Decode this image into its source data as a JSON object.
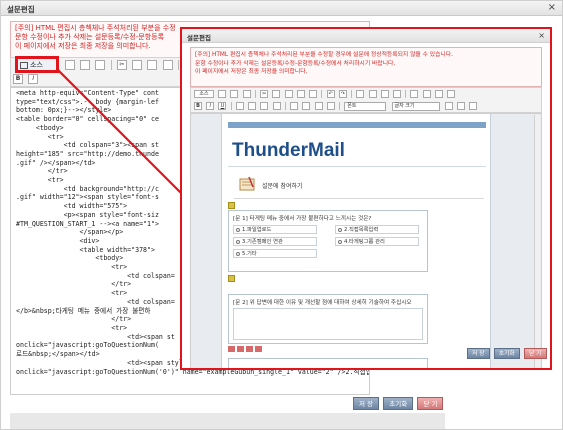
{
  "outer": {
    "title": "설문편집",
    "close_icon": "×",
    "notice_lines": [
      "[주의] HTML 편집시 층첵체나 주석처리된 부분을 수정",
      "문항 수정이나 추가 삭제는 설문등록/수정-문항등록",
      "이 페이지에서 저장은 최종 저장을 의미합니다."
    ],
    "source_button_label": "소스",
    "code_lines": [
      "<meta http-equiv=\"Content-Type\" cont",
      "type=\"text/css\">.-- body {margin-lef",
      "bottom: 0px;}--></style>",
      "<table border=\"0\" cellspacing=\"0\" ce",
      "     <tbody>",
      "        <tr>",
      "            <td colspan=\"3\"><span st",
      "height=\"185\" src=\"http://demo.thunde",
      ".gif\" /></span></td>",
      "        </tr>",
      "        <tr>",
      "            <td background=\"http://c",
      ".gif\" width=\"12\"><span style=\"font-s",
      "            <td width=\"575\">",
      "            <p><span style=\"font-siz",
      "#TM_QUESTION_START_1 --><a name=\"1\">",
      "                </span></p>",
      "                <div>",
      "                <table width=\"378\">",
      "                    <tbody>",
      "                        <tr>",
      "                            <td colspan=",
      "                        </tr>",
      "                        <tr>",
      "                            <td colspan=",
      "</b>&nbsp;타게팅 메뉴 중에서 가장 불편하",
      "                        </tr>",
      "                        <tr>",
      "                            <td><span st",
      "onclick=\"javascript:goToQuestionNum(",
      "로드&nbsp;</span></td>",
      "                            <td><span style=\"font-size: smaller\"><input type=\"radio\"",
      "onclick=\"javascript:goToQuestionNum('0')\" name=\"exampleGubun_single_1\" value=\"2\" />2.직접입"
    ],
    "buttons": {
      "save": "저 장",
      "reset": "초기화",
      "cancel": "닫 기"
    }
  },
  "inner": {
    "title": "설문편집",
    "close_icon": "×",
    "notice_lines": [
      "[주의] HTML 편집시 층첵체나 주석처리된 부분을 수정할 경우에 설문에 정상적등록되지 않을 수 있습니다.",
      "문항 수정이나 추가 삭제는 설문등록/수정-문항등록/수정에서 처리하시기 바랍니다.",
      "이 페이지에서 저장은 최종 저장을 의미합니다."
    ],
    "toolbar": {
      "source_label": "소스",
      "font_combo": "폰트",
      "size_combo": "글자 크기"
    },
    "mail": {
      "brand": "ThunderMail",
      "survey_heading": "설문에 참여하기",
      "q1_title": "[문 1] 타게팅 메뉴 중에서 가장 불편하다고 느끼시는 것은?",
      "q1_options": [
        "1.파일업로드",
        "2.직접목록입력",
        "3.기존캠페인 연관",
        "4.타게팅그룹 관리",
        "5.기타"
      ],
      "q2_title": "[문 2] 위 답변에 대한 이유 및 개선할 점에 대하여 상세히 기술하여 주십시오"
    },
    "buttons": {
      "save": "저 장",
      "reset": "초기화",
      "cancel": "닫 기"
    }
  },
  "colors": {
    "highlight_red": "#e0141a",
    "notice_red": "#d42222",
    "brand_blue": "#1f4f8a"
  }
}
